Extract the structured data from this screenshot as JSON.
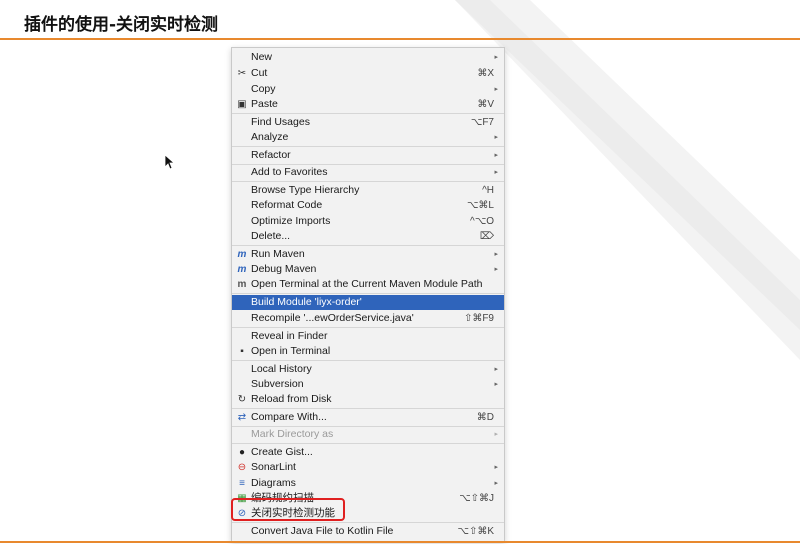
{
  "slide": {
    "title": "插件的使用-关闭实时检测"
  },
  "menu": {
    "items": [
      {
        "label": "New",
        "shortcut": "",
        "arrow": "▸",
        "icon": ""
      },
      {
        "label": "Cut",
        "shortcut": "⌘X",
        "arrow": "",
        "icon": "✂"
      },
      {
        "label": "Copy",
        "shortcut": "",
        "arrow": "▸",
        "icon": ""
      },
      {
        "label": "Paste",
        "shortcut": "⌘V",
        "arrow": "",
        "icon": "▣"
      },
      {
        "label": "Find Usages",
        "shortcut": "⌥F7",
        "arrow": "",
        "icon": ""
      },
      {
        "label": "Analyze",
        "shortcut": "",
        "arrow": "▸",
        "icon": ""
      },
      {
        "label": "Refactor",
        "shortcut": "",
        "arrow": "▸",
        "icon": ""
      },
      {
        "label": "Add to Favorites",
        "shortcut": "",
        "arrow": "▸",
        "icon": ""
      },
      {
        "label": "Browse Type Hierarchy",
        "shortcut": "^H",
        "arrow": "",
        "icon": ""
      },
      {
        "label": "Reformat Code",
        "shortcut": "⌥⌘L",
        "arrow": "",
        "icon": ""
      },
      {
        "label": "Optimize Imports",
        "shortcut": "^⌥O",
        "arrow": "",
        "icon": ""
      },
      {
        "label": "Delete...",
        "shortcut": "⌦",
        "arrow": "",
        "icon": ""
      },
      {
        "label": "Run Maven",
        "shortcut": "",
        "arrow": "▸",
        "icon": "m"
      },
      {
        "label": "Debug Maven",
        "shortcut": "",
        "arrow": "▸",
        "icon": "m"
      },
      {
        "label": "Open Terminal at the Current Maven Module Path",
        "shortcut": "",
        "arrow": "",
        "icon": "m"
      },
      {
        "label": "Build Module 'liyx-order'",
        "shortcut": "",
        "arrow": "",
        "icon": ""
      },
      {
        "label": "Recompile '...ewOrderService.java'",
        "shortcut": "⇧⌘F9",
        "arrow": "",
        "icon": ""
      },
      {
        "label": "Reveal in Finder",
        "shortcut": "",
        "arrow": "",
        "icon": ""
      },
      {
        "label": "Open in Terminal",
        "shortcut": "",
        "arrow": "",
        "icon": "▪"
      },
      {
        "label": "Local History",
        "shortcut": "",
        "arrow": "▸",
        "icon": ""
      },
      {
        "label": "Subversion",
        "shortcut": "",
        "arrow": "▸",
        "icon": ""
      },
      {
        "label": "Reload from Disk",
        "shortcut": "",
        "arrow": "",
        "icon": "↻"
      },
      {
        "label": "Compare With...",
        "shortcut": "⌘D",
        "arrow": "",
        "icon": "⇄"
      },
      {
        "label": "Mark Directory as",
        "shortcut": "",
        "arrow": "▸",
        "icon": ""
      },
      {
        "label": "Create Gist...",
        "shortcut": "",
        "arrow": "",
        "icon": "●"
      },
      {
        "label": "SonarLint",
        "shortcut": "",
        "arrow": "▸",
        "icon": "⊖"
      },
      {
        "label": "Diagrams",
        "shortcut": "",
        "arrow": "▸",
        "icon": "≡"
      },
      {
        "label": "编码规约扫描",
        "shortcut": "⌥⇧⌘J",
        "arrow": "",
        "icon": "▦"
      },
      {
        "label": "关闭实时检测功能",
        "shortcut": "",
        "arrow": "",
        "icon": "⊘"
      },
      {
        "label": "Convert Java File to Kotlin File",
        "shortcut": "⌥⇧⌘K",
        "arrow": "",
        "icon": ""
      }
    ]
  },
  "colors": {
    "accent_rule": "#e8892e",
    "selection": "#2f64bb",
    "highlight_box": "#e02020"
  }
}
